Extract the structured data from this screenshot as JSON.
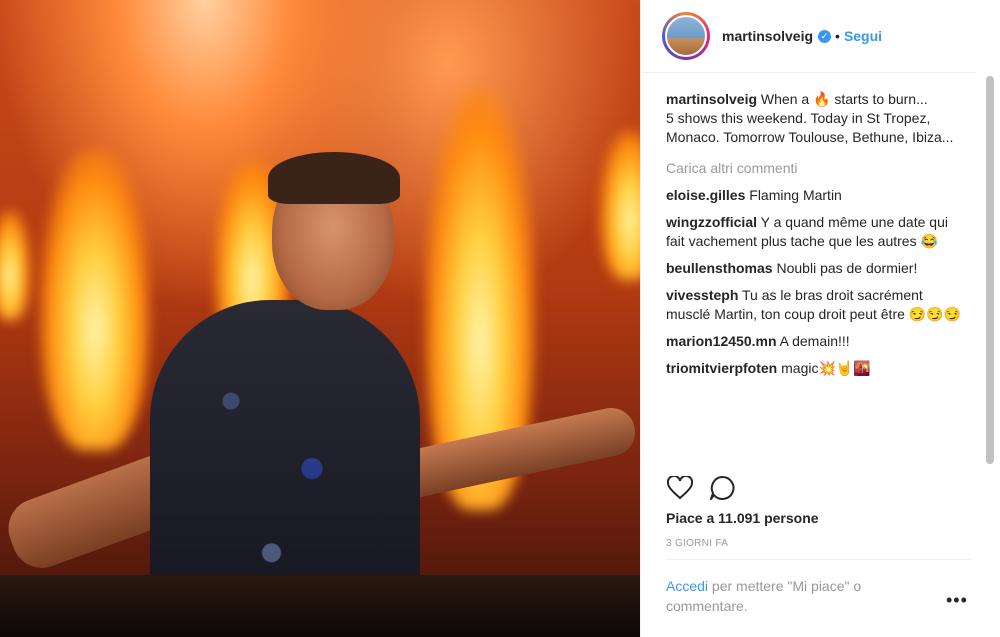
{
  "post": {
    "username": "martinsolveig",
    "verified_mark": "✓",
    "separator": "•",
    "follow_label": "Segui",
    "caption": {
      "user": "martinsolveig",
      "text": "When a 🔥 starts to burn...\n5 shows this weekend. Today in St Tropez, Monaco. Tomorrow Toulouse, Bethune, Ibiza..."
    },
    "load_more_label": "Carica altri commenti",
    "comments": [
      {
        "user": "eloise.gilles",
        "text": "Flaming Martin"
      },
      {
        "user": "wingzzofficial",
        "text": "Y a quand même une date qui fait vachement plus tache que les autres 😂"
      },
      {
        "user": "beullensthomas",
        "text": "Noubli pas de dormier!"
      },
      {
        "user": "vivessteph",
        "text": "Tu as le bras droit sacrément musclé Martin, ton coup droit peut être 😏😏😏"
      },
      {
        "user": "marion12450.mn",
        "text": "A demain!!!"
      },
      {
        "user": "triomitvierpfoten",
        "text": "magic💥🤘🌇"
      }
    ],
    "likes_label": "Piace a 11.091 persone",
    "time_label": "3 GIORNI FA",
    "login_link": "Accedi",
    "login_text": "per mettere \"Mi piace\" o commentare.",
    "more_label": "•••"
  },
  "icons": [
    "heart-icon",
    "comment-icon",
    "verified-icon"
  ],
  "colors": {
    "accent": "#3897f0",
    "text": "#262626",
    "muted": "#999999"
  }
}
